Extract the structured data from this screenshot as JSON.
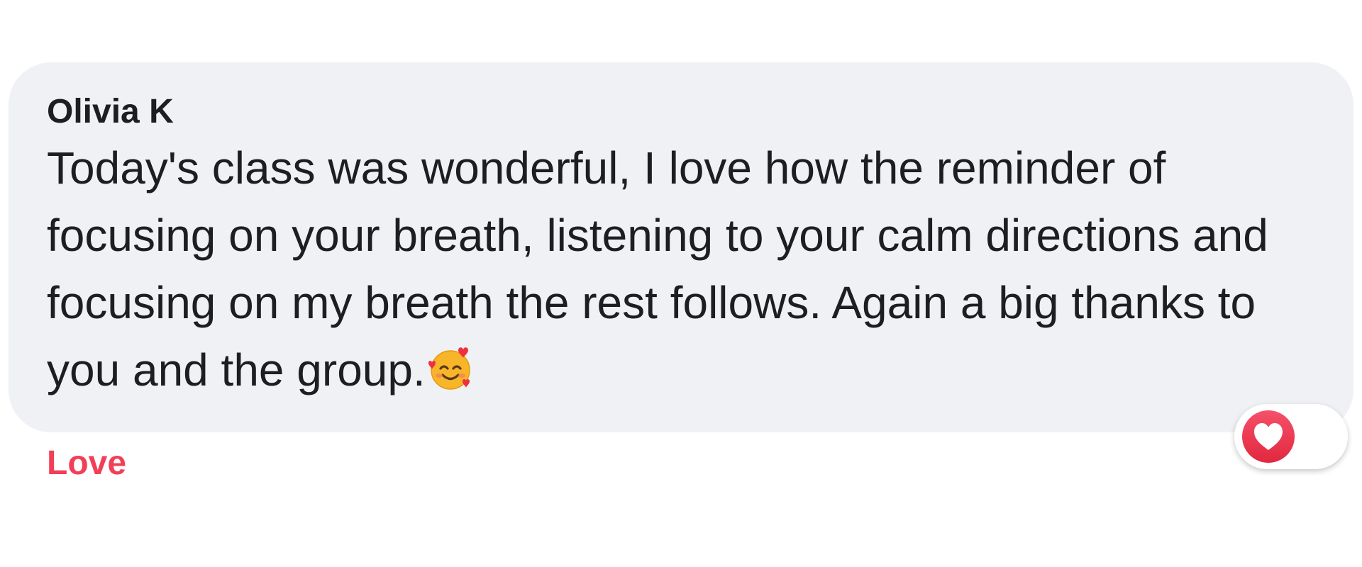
{
  "comment": {
    "author": "Olivia K",
    "text": "Today's class was wonderful, I love how the reminder of focusing on your breath, listening to your calm directions and focusing on my breath the rest follows. Again a big thanks to you and the group.",
    "emoji_icon": "smiling-face-with-hearts-icon"
  },
  "actions": {
    "reaction_label": "Love",
    "reaction_color": "#f33e58"
  },
  "reactions": {
    "icon": "love-heart-icon",
    "color": "#f33e58"
  },
  "colors": {
    "bubble_background": "#f0f1f5",
    "text": "#1c1e21"
  }
}
